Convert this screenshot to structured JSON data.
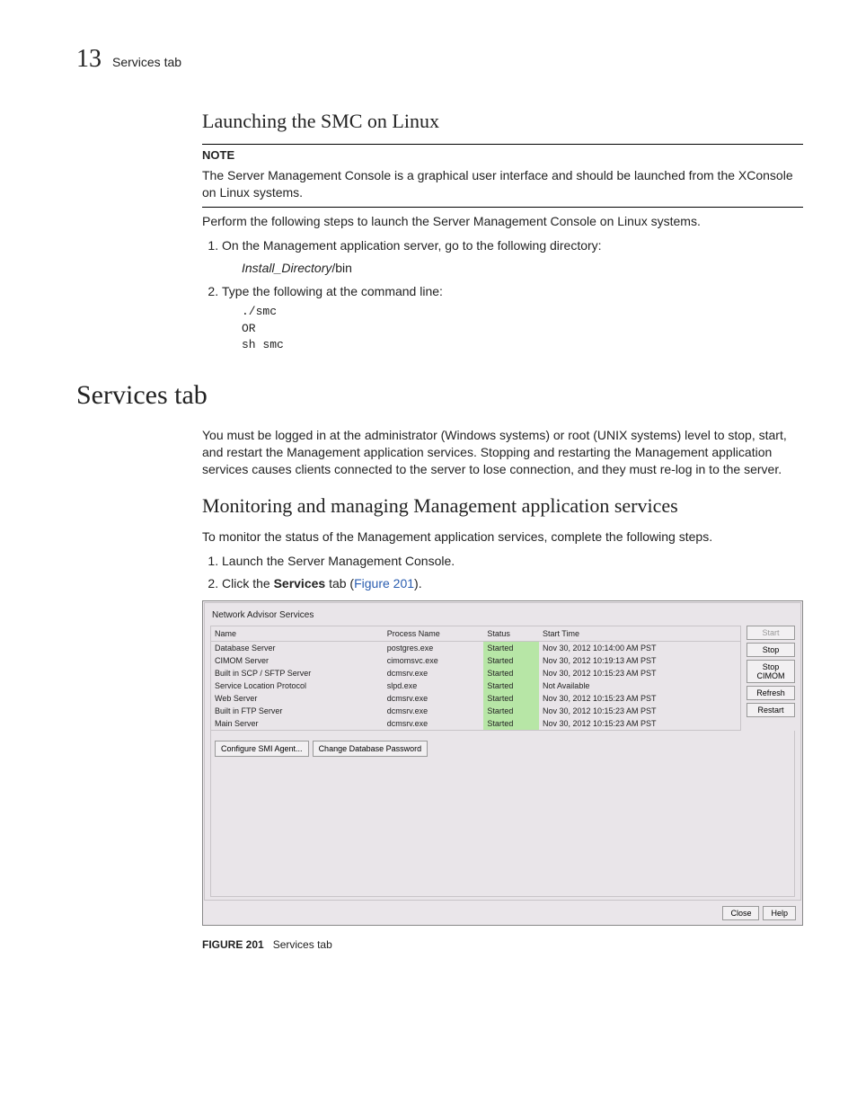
{
  "header": {
    "chapter_number": "13",
    "chapter_title": "Services tab"
  },
  "sec1": {
    "title": "Launching the SMC on Linux",
    "note_label": "NOTE",
    "note_text": "The Server Management Console is a graphical user interface and should be launched from the XConsole on Linux systems.",
    "intro": "Perform the following steps to launch the Server Management Console on Linux systems.",
    "step1": "On the Management application server, go to the following directory:",
    "step1_sub_italic": "Install_Directory",
    "step1_sub_rest": "/bin",
    "step2": "Type the following at the command line:",
    "cmd1": "./smc",
    "cmd2": "OR",
    "cmd3": "sh smc"
  },
  "main_heading": "Services tab",
  "sec2_intro": "You must be logged in at the administrator (Windows systems) or root (UNIX systems) level to stop, start, and restart the Management application services. Stopping and restarting the Management application services causes clients connected to the server to lose connection, and they must re-log in to the server.",
  "sec3": {
    "title": "Monitoring and managing Management application services",
    "intro": "To monitor the status of the Management application services, complete the following steps.",
    "step1": "Launch the Server Management Console.",
    "step2_a": "Click the ",
    "step2_b": "Services",
    "step2_c": " tab (",
    "step2_link": "Figure 201",
    "step2_d": ")."
  },
  "figure": {
    "panel_title": "Network Advisor Services",
    "cols": {
      "c1": "Name",
      "c2": "Process Name",
      "c3": "Status",
      "c4": "Start Time"
    },
    "rows": [
      {
        "name": "Database Server",
        "proc": "postgres.exe",
        "status": "Started",
        "time": "Nov 30, 2012 10:14:00 AM PST"
      },
      {
        "name": "CIMOM Server",
        "proc": "cimomsvc.exe",
        "status": "Started",
        "time": "Nov 30, 2012 10:19:13 AM PST"
      },
      {
        "name": "Built in SCP / SFTP Server",
        "proc": "dcmsrv.exe",
        "status": "Started",
        "time": "Nov 30, 2012 10:15:23 AM PST"
      },
      {
        "name": "Service Location Protocol",
        "proc": "slpd.exe",
        "status": "Started",
        "time": "Not Available"
      },
      {
        "name": "Web Server",
        "proc": "dcmsrv.exe",
        "status": "Started",
        "time": "Nov 30, 2012 10:15:23 AM PST"
      },
      {
        "name": "Built in FTP Server",
        "proc": "dcmsrv.exe",
        "status": "Started",
        "time": "Nov 30, 2012 10:15:23 AM PST"
      },
      {
        "name": "Main Server",
        "proc": "dcmsrv.exe",
        "status": "Started",
        "time": "Nov 30, 2012 10:15:23 AM PST"
      }
    ],
    "buttons": {
      "start": "Start",
      "stop": "Stop",
      "stop_cimom": "Stop CIMOM",
      "refresh": "Refresh",
      "restart": "Restart",
      "configure": "Configure SMI Agent...",
      "change_pw": "Change Database Password",
      "close": "Close",
      "help": "Help"
    },
    "caption_label": "FIGURE 201",
    "caption_text": "Services tab"
  }
}
